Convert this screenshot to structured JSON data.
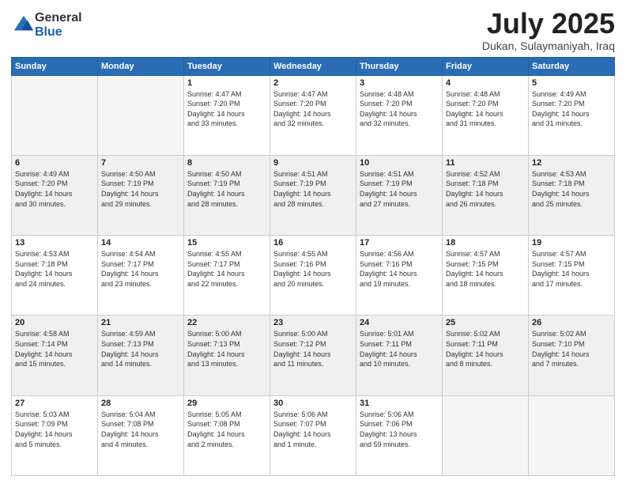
{
  "logo": {
    "general": "General",
    "blue": "Blue"
  },
  "title": "July 2025",
  "location": "Dukan, Sulaymaniyah, Iraq",
  "days_header": [
    "Sunday",
    "Monday",
    "Tuesday",
    "Wednesday",
    "Thursday",
    "Friday",
    "Saturday"
  ],
  "weeks": [
    [
      {
        "day": "",
        "info": ""
      },
      {
        "day": "",
        "info": ""
      },
      {
        "day": "1",
        "info": "Sunrise: 4:47 AM\nSunset: 7:20 PM\nDaylight: 14 hours\nand 33 minutes."
      },
      {
        "day": "2",
        "info": "Sunrise: 4:47 AM\nSunset: 7:20 PM\nDaylight: 14 hours\nand 32 minutes."
      },
      {
        "day": "3",
        "info": "Sunrise: 4:48 AM\nSunset: 7:20 PM\nDaylight: 14 hours\nand 32 minutes."
      },
      {
        "day": "4",
        "info": "Sunrise: 4:48 AM\nSunset: 7:20 PM\nDaylight: 14 hours\nand 31 minutes."
      },
      {
        "day": "5",
        "info": "Sunrise: 4:49 AM\nSunset: 7:20 PM\nDaylight: 14 hours\nand 31 minutes."
      }
    ],
    [
      {
        "day": "6",
        "info": "Sunrise: 4:49 AM\nSunset: 7:20 PM\nDaylight: 14 hours\nand 30 minutes."
      },
      {
        "day": "7",
        "info": "Sunrise: 4:50 AM\nSunset: 7:19 PM\nDaylight: 14 hours\nand 29 minutes."
      },
      {
        "day": "8",
        "info": "Sunrise: 4:50 AM\nSunset: 7:19 PM\nDaylight: 14 hours\nand 28 minutes."
      },
      {
        "day": "9",
        "info": "Sunrise: 4:51 AM\nSunset: 7:19 PM\nDaylight: 14 hours\nand 28 minutes."
      },
      {
        "day": "10",
        "info": "Sunrise: 4:51 AM\nSunset: 7:19 PM\nDaylight: 14 hours\nand 27 minutes."
      },
      {
        "day": "11",
        "info": "Sunrise: 4:52 AM\nSunset: 7:18 PM\nDaylight: 14 hours\nand 26 minutes."
      },
      {
        "day": "12",
        "info": "Sunrise: 4:53 AM\nSunset: 7:18 PM\nDaylight: 14 hours\nand 25 minutes."
      }
    ],
    [
      {
        "day": "13",
        "info": "Sunrise: 4:53 AM\nSunset: 7:18 PM\nDaylight: 14 hours\nand 24 minutes."
      },
      {
        "day": "14",
        "info": "Sunrise: 4:54 AM\nSunset: 7:17 PM\nDaylight: 14 hours\nand 23 minutes."
      },
      {
        "day": "15",
        "info": "Sunrise: 4:55 AM\nSunset: 7:17 PM\nDaylight: 14 hours\nand 22 minutes."
      },
      {
        "day": "16",
        "info": "Sunrise: 4:55 AM\nSunset: 7:16 PM\nDaylight: 14 hours\nand 20 minutes."
      },
      {
        "day": "17",
        "info": "Sunrise: 4:56 AM\nSunset: 7:16 PM\nDaylight: 14 hours\nand 19 minutes."
      },
      {
        "day": "18",
        "info": "Sunrise: 4:57 AM\nSunset: 7:15 PM\nDaylight: 14 hours\nand 18 minutes."
      },
      {
        "day": "19",
        "info": "Sunrise: 4:57 AM\nSunset: 7:15 PM\nDaylight: 14 hours\nand 17 minutes."
      }
    ],
    [
      {
        "day": "20",
        "info": "Sunrise: 4:58 AM\nSunset: 7:14 PM\nDaylight: 14 hours\nand 15 minutes."
      },
      {
        "day": "21",
        "info": "Sunrise: 4:59 AM\nSunset: 7:13 PM\nDaylight: 14 hours\nand 14 minutes."
      },
      {
        "day": "22",
        "info": "Sunrise: 5:00 AM\nSunset: 7:13 PM\nDaylight: 14 hours\nand 13 minutes."
      },
      {
        "day": "23",
        "info": "Sunrise: 5:00 AM\nSunset: 7:12 PM\nDaylight: 14 hours\nand 11 minutes."
      },
      {
        "day": "24",
        "info": "Sunrise: 5:01 AM\nSunset: 7:11 PM\nDaylight: 14 hours\nand 10 minutes."
      },
      {
        "day": "25",
        "info": "Sunrise: 5:02 AM\nSunset: 7:11 PM\nDaylight: 14 hours\nand 8 minutes."
      },
      {
        "day": "26",
        "info": "Sunrise: 5:02 AM\nSunset: 7:10 PM\nDaylight: 14 hours\nand 7 minutes."
      }
    ],
    [
      {
        "day": "27",
        "info": "Sunrise: 5:03 AM\nSunset: 7:09 PM\nDaylight: 14 hours\nand 5 minutes."
      },
      {
        "day": "28",
        "info": "Sunrise: 5:04 AM\nSunset: 7:08 PM\nDaylight: 14 hours\nand 4 minutes."
      },
      {
        "day": "29",
        "info": "Sunrise: 5:05 AM\nSunset: 7:08 PM\nDaylight: 14 hours\nand 2 minutes."
      },
      {
        "day": "30",
        "info": "Sunrise: 5:06 AM\nSunset: 7:07 PM\nDaylight: 14 hours\nand 1 minute."
      },
      {
        "day": "31",
        "info": "Sunrise: 5:06 AM\nSunset: 7:06 PM\nDaylight: 13 hours\nand 59 minutes."
      },
      {
        "day": "",
        "info": ""
      },
      {
        "day": "",
        "info": ""
      }
    ]
  ]
}
